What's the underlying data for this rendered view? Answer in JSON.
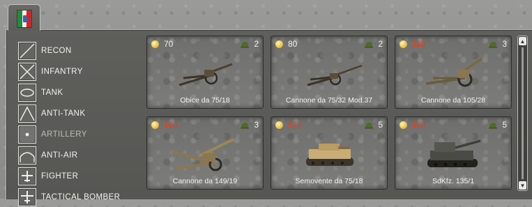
{
  "nation": {
    "flag_icon": "italy-flag-icon"
  },
  "categories": [
    {
      "label": "RECON",
      "icon": "recon-icon",
      "active": false
    },
    {
      "label": "INFANTRY",
      "icon": "infantry-icon",
      "active": false
    },
    {
      "label": "TANK",
      "icon": "tank-icon",
      "active": false
    },
    {
      "label": "ANTI-TANK",
      "icon": "anti-tank-icon",
      "active": false
    },
    {
      "label": "ARTILLERY",
      "icon": "artillery-icon",
      "active": true
    },
    {
      "label": "ANTI-AIR",
      "icon": "anti-air-icon",
      "active": false
    },
    {
      "label": "FIGHTER",
      "icon": "fighter-icon",
      "active": false
    },
    {
      "label": "TACTICAL BOMBER",
      "icon": "tactical-bomber-icon",
      "active": false
    }
  ],
  "units": [
    {
      "name": "Obice da 75/18",
      "cost": "70",
      "cost_affordable": true,
      "count": "2"
    },
    {
      "name": "Cannone da 75/32 Mod.37",
      "cost": "80",
      "cost_affordable": true,
      "count": "2"
    },
    {
      "name": "Cannone da 105/28",
      "cost": "110",
      "cost_affordable": false,
      "count": "3"
    },
    {
      "name": "Cannone da 149/19",
      "cost": "160",
      "cost_affordable": false,
      "count": "3"
    },
    {
      "name": "Semovente da 75/18",
      "cost": "170",
      "cost_affordable": false,
      "count": "5"
    },
    {
      "name": "SdKfz. 135/1",
      "cost": "190",
      "cost_affordable": false,
      "count": "5"
    }
  ],
  "colors": {
    "cost_ok": "#f0f0ee",
    "cost_too_high": "#e0401f",
    "coin": "#e8c24a",
    "helmet": "#4f6b2a"
  }
}
